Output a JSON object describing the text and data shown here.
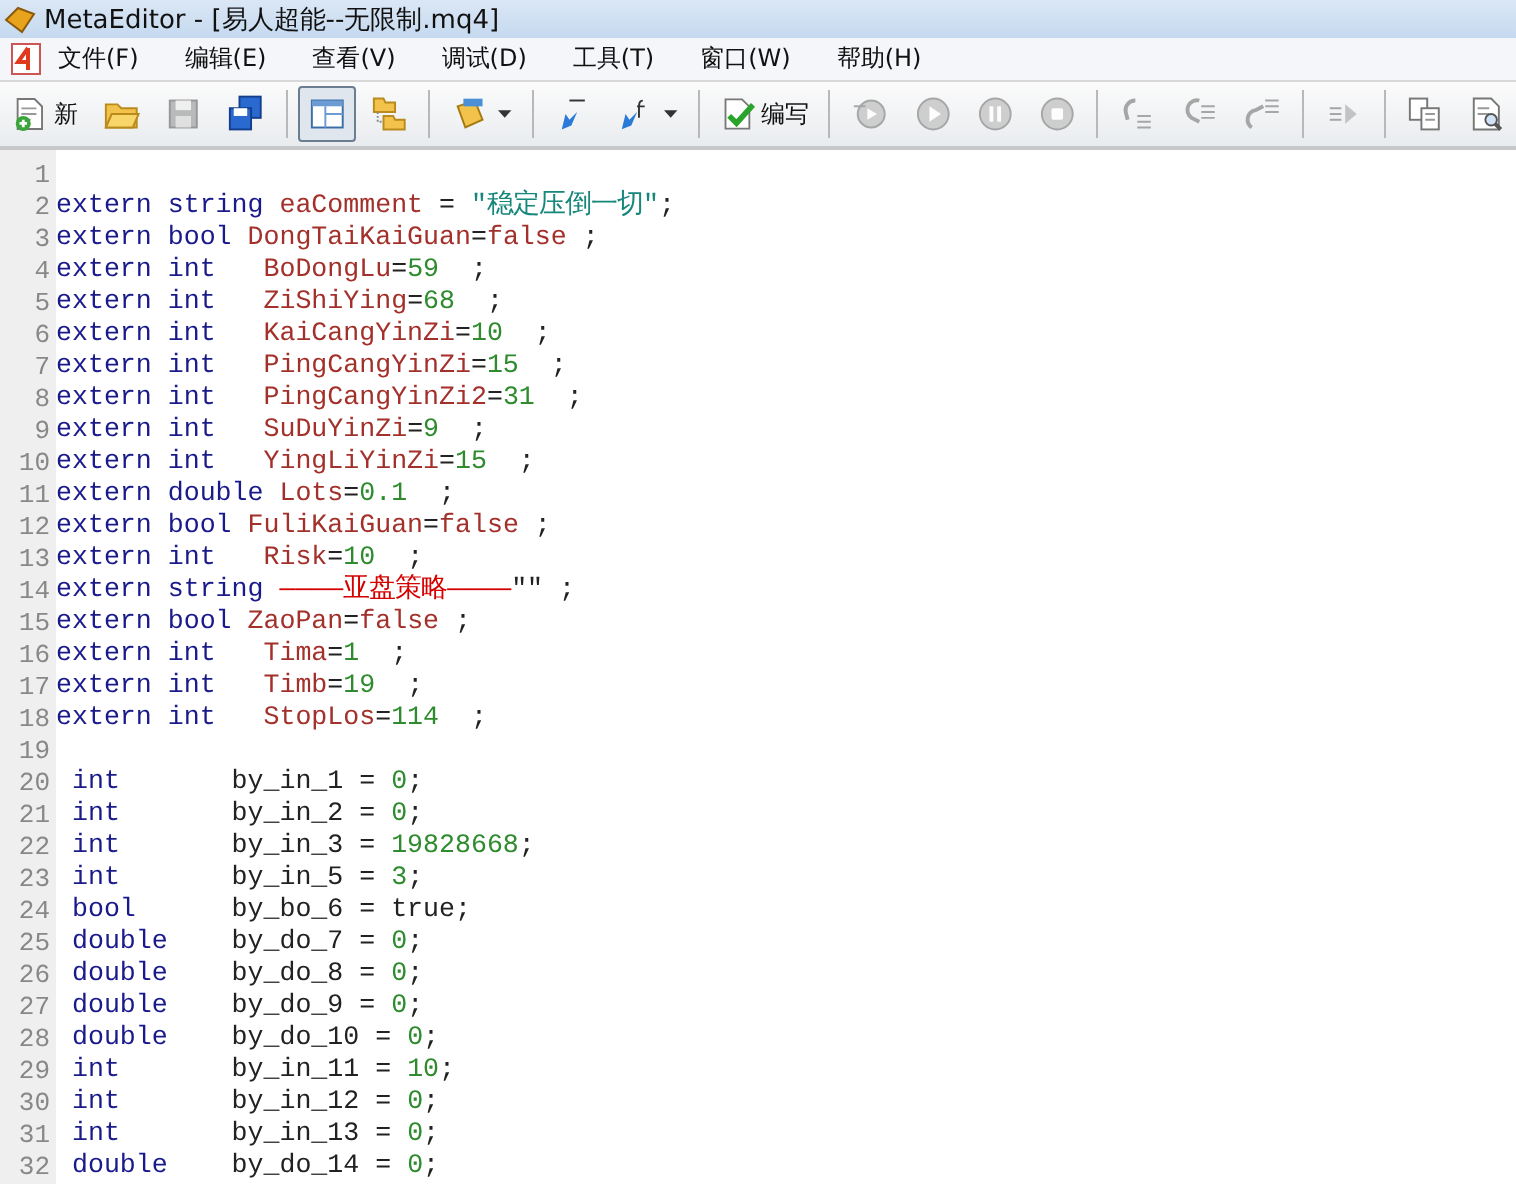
{
  "window": {
    "title": "MetaEditor - [易人超能--无限制.mq4]"
  },
  "menu": [
    "文件(F)",
    "编辑(E)",
    "查看(V)",
    "调试(D)",
    "工具(T)",
    "窗口(W)",
    "帮助(H)"
  ],
  "toolbar": [
    {
      "kind": "new",
      "label": "新",
      "selected": false,
      "disabled": false
    },
    {
      "kind": "open",
      "selected": false,
      "disabled": false
    },
    {
      "kind": "save",
      "selected": false,
      "disabled": true
    },
    {
      "kind": "save-all",
      "selected": false,
      "disabled": false
    },
    {
      "kind": "separator"
    },
    {
      "kind": "layout",
      "selected": true,
      "disabled": false
    },
    {
      "kind": "folders",
      "selected": false,
      "disabled": false
    },
    {
      "kind": "separator"
    },
    {
      "kind": "cards",
      "dropdown": true,
      "selected": false,
      "disabled": false
    },
    {
      "kind": "separator"
    },
    {
      "kind": "var",
      "selected": false,
      "disabled": false
    },
    {
      "kind": "func",
      "dropdown": true,
      "selected": false,
      "disabled": false
    },
    {
      "kind": "separator"
    },
    {
      "kind": "compile",
      "label": "编写",
      "selected": false,
      "disabled": false
    },
    {
      "kind": "separator"
    },
    {
      "kind": "restart",
      "selected": false,
      "disabled": true
    },
    {
      "kind": "play",
      "selected": false,
      "disabled": true
    },
    {
      "kind": "pause",
      "selected": false,
      "disabled": true
    },
    {
      "kind": "stop",
      "selected": false,
      "disabled": true
    },
    {
      "kind": "separator"
    },
    {
      "kind": "step-in",
      "selected": false,
      "disabled": true
    },
    {
      "kind": "step-over",
      "selected": false,
      "disabled": true
    },
    {
      "kind": "step-out",
      "selected": false,
      "disabled": true
    },
    {
      "kind": "separator"
    },
    {
      "kind": "indent",
      "selected": false,
      "disabled": true
    },
    {
      "kind": "separator"
    },
    {
      "kind": "copy",
      "selected": false,
      "disabled": false
    },
    {
      "kind": "preview",
      "selected": false,
      "disabled": false
    }
  ],
  "lines": [
    {
      "number": "1"
    },
    {
      "number": "2",
      "tokens": [
        {
          "kind": "keyword",
          "text": "extern string "
        },
        {
          "kind": "ident",
          "text": "eaComment"
        },
        {
          "kind": "plain",
          "text": " = "
        },
        {
          "kind": "string",
          "text": "\"稳定压倒一切\""
        },
        {
          "kind": "plain",
          "text": ";"
        }
      ]
    },
    {
      "number": "3",
      "tokens": [
        {
          "kind": "keyword",
          "text": "extern bool "
        },
        {
          "kind": "ident",
          "text": "DongTaiKaiGuan"
        },
        {
          "kind": "plain",
          "text": "="
        },
        {
          "kind": "ident",
          "text": "false"
        },
        {
          "kind": "plain",
          "text": " ;"
        }
      ]
    },
    {
      "number": "4",
      "tokens": [
        {
          "kind": "keyword",
          "text": "extern int   "
        },
        {
          "kind": "ident",
          "text": "BoDongLu"
        },
        {
          "kind": "plain",
          "text": "="
        },
        {
          "kind": "number",
          "text": "59"
        },
        {
          "kind": "plain",
          "text": "  ;"
        }
      ]
    },
    {
      "number": "5",
      "tokens": [
        {
          "kind": "keyword",
          "text": "extern int   "
        },
        {
          "kind": "ident",
          "text": "ZiShiYing"
        },
        {
          "kind": "plain",
          "text": "="
        },
        {
          "kind": "number",
          "text": "68"
        },
        {
          "kind": "plain",
          "text": "  ;"
        }
      ]
    },
    {
      "number": "6",
      "tokens": [
        {
          "kind": "keyword",
          "text": "extern int   "
        },
        {
          "kind": "ident",
          "text": "KaiCangYinZi"
        },
        {
          "kind": "plain",
          "text": "="
        },
        {
          "kind": "number",
          "text": "10"
        },
        {
          "kind": "plain",
          "text": "  ;"
        }
      ]
    },
    {
      "number": "7",
      "tokens": [
        {
          "kind": "keyword",
          "text": "extern int   "
        },
        {
          "kind": "ident",
          "text": "PingCangYinZi"
        },
        {
          "kind": "plain",
          "text": "="
        },
        {
          "kind": "number",
          "text": "15"
        },
        {
          "kind": "plain",
          "text": "  ;"
        }
      ]
    },
    {
      "number": "8",
      "tokens": [
        {
          "kind": "keyword",
          "text": "extern int   "
        },
        {
          "kind": "ident",
          "text": "PingCangYinZi2"
        },
        {
          "kind": "plain",
          "text": "="
        },
        {
          "kind": "number",
          "text": "31"
        },
        {
          "kind": "plain",
          "text": "  ;"
        }
      ]
    },
    {
      "number": "9",
      "tokens": [
        {
          "kind": "keyword",
          "text": "extern int   "
        },
        {
          "kind": "ident",
          "text": "SuDuYinZi"
        },
        {
          "kind": "plain",
          "text": "="
        },
        {
          "kind": "number",
          "text": "9"
        },
        {
          "kind": "plain",
          "text": "  ;"
        }
      ]
    },
    {
      "number": "10",
      "tokens": [
        {
          "kind": "keyword",
          "text": "extern int   "
        },
        {
          "kind": "ident",
          "text": "YingLiYinZi"
        },
        {
          "kind": "plain",
          "text": "="
        },
        {
          "kind": "number",
          "text": "15"
        },
        {
          "kind": "plain",
          "text": "  ;"
        }
      ]
    },
    {
      "number": "11",
      "tokens": [
        {
          "kind": "keyword",
          "text": "extern double "
        },
        {
          "kind": "ident",
          "text": "Lots"
        },
        {
          "kind": "plain",
          "text": "="
        },
        {
          "kind": "number",
          "text": "0.1"
        },
        {
          "kind": "plain",
          "text": "  ;"
        }
      ]
    },
    {
      "number": "12",
      "tokens": [
        {
          "kind": "keyword",
          "text": "extern bool "
        },
        {
          "kind": "ident",
          "text": "FuliKaiGuan"
        },
        {
          "kind": "plain",
          "text": "="
        },
        {
          "kind": "ident",
          "text": "false"
        },
        {
          "kind": "plain",
          "text": " ;"
        }
      ]
    },
    {
      "number": "13",
      "tokens": [
        {
          "kind": "keyword",
          "text": "extern int   "
        },
        {
          "kind": "ident",
          "text": "Risk"
        },
        {
          "kind": "plain",
          "text": "="
        },
        {
          "kind": "number",
          "text": "10"
        },
        {
          "kind": "plain",
          "text": "  ;"
        }
      ]
    },
    {
      "number": "14",
      "tokens": [
        {
          "kind": "keyword",
          "text": "extern string "
        },
        {
          "kind": "error",
          "text": "————亚盘策略————"
        },
        {
          "kind": "plain",
          "text": "\"\" ;"
        }
      ]
    },
    {
      "number": "15",
      "tokens": [
        {
          "kind": "keyword",
          "text": "extern bool "
        },
        {
          "kind": "ident",
          "text": "ZaoPan"
        },
        {
          "kind": "plain",
          "text": "="
        },
        {
          "kind": "ident",
          "text": "false"
        },
        {
          "kind": "plain",
          "text": " ;"
        }
      ]
    },
    {
      "number": "16",
      "tokens": [
        {
          "kind": "keyword",
          "text": "extern int   "
        },
        {
          "kind": "ident",
          "text": "Tima"
        },
        {
          "kind": "plain",
          "text": "="
        },
        {
          "kind": "number",
          "text": "1"
        },
        {
          "kind": "plain",
          "text": "  ;"
        }
      ]
    },
    {
      "number": "17",
      "tokens": [
        {
          "kind": "keyword",
          "text": "extern int   "
        },
        {
          "kind": "ident",
          "text": "Timb"
        },
        {
          "kind": "plain",
          "text": "="
        },
        {
          "kind": "number",
          "text": "19"
        },
        {
          "kind": "plain",
          "text": "  ;"
        }
      ]
    },
    {
      "number": "18",
      "tokens": [
        {
          "kind": "keyword",
          "text": "extern int   "
        },
        {
          "kind": "ident",
          "text": "StopLos"
        },
        {
          "kind": "plain",
          "text": "="
        },
        {
          "kind": "number",
          "text": "114"
        },
        {
          "kind": "plain",
          "text": "  ;"
        }
      ]
    },
    {
      "number": "19"
    },
    {
      "number": "20",
      "tokens": [
        {
          "kind": "keyword",
          "text": " int       "
        },
        {
          "kind": "plain",
          "text": "by_in_1 = "
        },
        {
          "kind": "number",
          "text": "0"
        },
        {
          "kind": "plain",
          "text": ";"
        }
      ]
    },
    {
      "number": "21",
      "tokens": [
        {
          "kind": "keyword",
          "text": " int       "
        },
        {
          "kind": "plain",
          "text": "by_in_2 = "
        },
        {
          "kind": "number",
          "text": "0"
        },
        {
          "kind": "plain",
          "text": ";"
        }
      ]
    },
    {
      "number": "22",
      "tokens": [
        {
          "kind": "keyword",
          "text": " int       "
        },
        {
          "kind": "plain",
          "text": "by_in_3 = "
        },
        {
          "kind": "number",
          "text": "19828668"
        },
        {
          "kind": "plain",
          "text": ";"
        }
      ]
    },
    {
      "number": "23",
      "tokens": [
        {
          "kind": "keyword",
          "text": " int       "
        },
        {
          "kind": "plain",
          "text": "by_in_5 = "
        },
        {
          "kind": "number",
          "text": "3"
        },
        {
          "kind": "plain",
          "text": ";"
        }
      ]
    },
    {
      "number": "24",
      "tokens": [
        {
          "kind": "keyword",
          "text": " bool      "
        },
        {
          "kind": "plain",
          "text": "by_bo_6 = true;"
        }
      ]
    },
    {
      "number": "25",
      "tokens": [
        {
          "kind": "keyword",
          "text": " double    "
        },
        {
          "kind": "plain",
          "text": "by_do_7 = "
        },
        {
          "kind": "number",
          "text": "0"
        },
        {
          "kind": "plain",
          "text": ";"
        }
      ]
    },
    {
      "number": "26",
      "tokens": [
        {
          "kind": "keyword",
          "text": " double    "
        },
        {
          "kind": "plain",
          "text": "by_do_8 = "
        },
        {
          "kind": "number",
          "text": "0"
        },
        {
          "kind": "plain",
          "text": ";"
        }
      ]
    },
    {
      "number": "27",
      "tokens": [
        {
          "kind": "keyword",
          "text": " double    "
        },
        {
          "kind": "plain",
          "text": "by_do_9 = "
        },
        {
          "kind": "number",
          "text": "0"
        },
        {
          "kind": "plain",
          "text": ";"
        }
      ]
    },
    {
      "number": "28",
      "tokens": [
        {
          "kind": "keyword",
          "text": " double    "
        },
        {
          "kind": "plain",
          "text": "by_do_10 = "
        },
        {
          "kind": "number",
          "text": "0"
        },
        {
          "kind": "plain",
          "text": ";"
        }
      ]
    },
    {
      "number": "29",
      "tokens": [
        {
          "kind": "keyword",
          "text": " int       "
        },
        {
          "kind": "plain",
          "text": "by_in_11 = "
        },
        {
          "kind": "number",
          "text": "10"
        },
        {
          "kind": "plain",
          "text": ";"
        }
      ]
    },
    {
      "number": "30",
      "tokens": [
        {
          "kind": "keyword",
          "text": " int       "
        },
        {
          "kind": "plain",
          "text": "by_in_12 = "
        },
        {
          "kind": "number",
          "text": "0"
        },
        {
          "kind": "plain",
          "text": ";"
        }
      ]
    },
    {
      "number": "31",
      "tokens": [
        {
          "kind": "keyword",
          "text": " int       "
        },
        {
          "kind": "plain",
          "text": "by_in_13 = "
        },
        {
          "kind": "number",
          "text": "0"
        },
        {
          "kind": "plain",
          "text": ";"
        }
      ]
    },
    {
      "number": "32",
      "tokens": [
        {
          "kind": "keyword",
          "text": " double    "
        },
        {
          "kind": "plain",
          "text": "by_do_14 = "
        },
        {
          "kind": "number",
          "text": "0"
        },
        {
          "kind": "plain",
          "text": ";"
        }
      ]
    }
  ]
}
